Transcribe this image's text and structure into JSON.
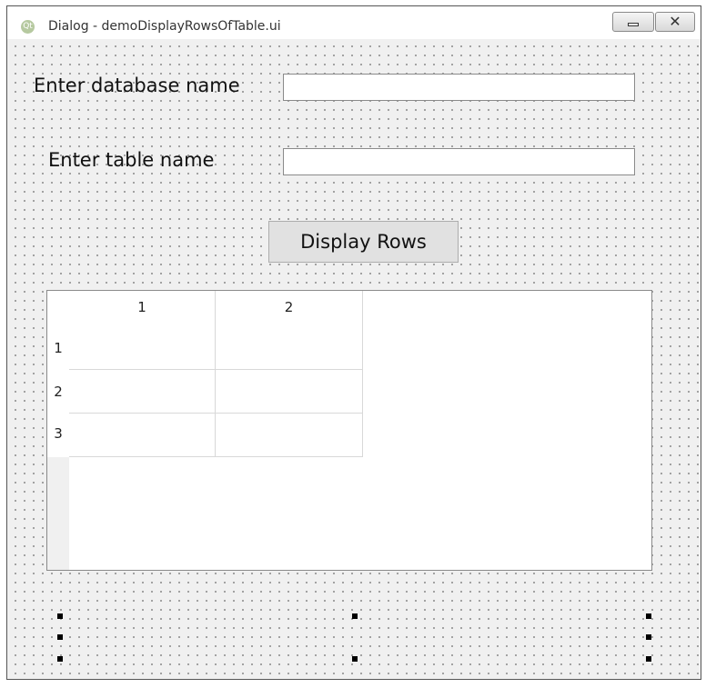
{
  "window": {
    "title": "Dialog - demoDisplayRowsOfTable.ui",
    "logo_text": "Qt",
    "close_glyph": "✕"
  },
  "form": {
    "database_label": "Enter database name",
    "database_value": "",
    "table_label": "Enter table name",
    "table_value": "",
    "display_button_label": "Display Rows"
  },
  "table": {
    "columns": [
      "1",
      "2"
    ],
    "rows": [
      "1",
      "2",
      "3"
    ]
  },
  "icons": {
    "app": "qt-logo-icon",
    "minimize": "minimize-icon",
    "close": "close-icon"
  }
}
